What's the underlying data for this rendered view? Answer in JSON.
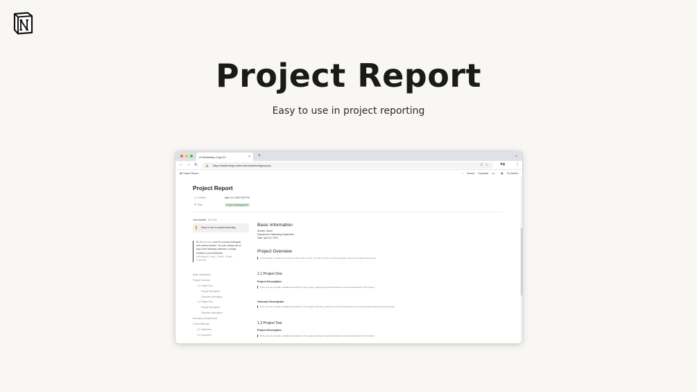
{
  "hero": {
    "title": "Project Report",
    "subtitle": "Easy to use in project reporting"
  },
  "browser": {
    "tab_title": "AI Marketing Copy 03",
    "tab_close": "×",
    "new_tab": "+",
    "tab_menu": "⌄",
    "back": "←",
    "forward": "→",
    "reload": "↻",
    "url": "https://kaiblnding.notion.site/aimarketingcopyos",
    "url_icons": "⇪☆",
    "ext_icons": "✱▮",
    "menu": "⋮"
  },
  "notion_topbar": {
    "breadcrumb": "Project Report",
    "search": "Search",
    "duplicate": "Duplicate",
    "more": "•••",
    "try_notion": "Try Notion"
  },
  "page": {
    "title": "Project Report",
    "properties": [
      {
        "label": "Created",
        "value": "April 14, 2023 3:29 PM"
      },
      {
        "label": "Tags",
        "value": "Project Management"
      }
    ],
    "last_updated_label": "Last Update:",
    "last_updated_value": "@Today",
    "callout": "Easy to use in project reporting",
    "quote": {
      "line1": "Hi, I'm",
      "handle": "@Kaibe",
      "line1b": ", and I'm a product designer",
      "line2": "and content creator. You can contact me at",
      "line3": "any of the following channels. Looking",
      "line4": "forward to your feedback!",
      "links1": "Kaimingchu , blog , Twitter , Email ,",
      "links2": "Gumroad"
    },
    "toc": [
      {
        "label": "Basic Information",
        "level": 1
      },
      {
        "label": "Project Overview",
        "level": 1
      },
      {
        "label": "1.1 Project One",
        "level": 2
      },
      {
        "label": "Project Description",
        "level": 3
      },
      {
        "label": "Outcome Description",
        "level": 3
      },
      {
        "label": "1.2 Project Two",
        "level": 2
      },
      {
        "label": "Project Description",
        "level": 3
      },
      {
        "label": "Outcome Description",
        "level": 3
      },
      {
        "label": "Summary of Experience",
        "level": 1
      },
      {
        "label": "Future Planning",
        "level": 1
      },
      {
        "label": "2.1 Short-term",
        "level": 2
      },
      {
        "label": "2.2 Long-term",
        "level": 2
      }
    ],
    "basic_info": {
      "heading": "Basic Information",
      "sender": "Sender: David",
      "department": "Department: Marketing Department",
      "date": "Date: April 16, 2023"
    },
    "overview": {
      "heading": "Project Overview",
      "quote": "In this section, provide an overview of the work content. You can use @ to mention people's names and attach documents."
    },
    "project_one": {
      "heading": "1.1 Project One",
      "desc_heading": "Project Description",
      "desc_quote": "Here you can provide a detailed description of the project, giving an overall introduction to the actual status of the project.",
      "outcome_heading": "Outcome Description",
      "outcome_quote": "Here you can provide a detailed description of the project outcomes, giving an overall introduction to the actual results achieved by the project."
    },
    "project_two": {
      "heading": "1.2 Project Two",
      "desc_heading": "Project Description",
      "desc_quote": "Here you can provide a detailed description of the project, giving an overall introduction to the actual status of the project."
    }
  }
}
